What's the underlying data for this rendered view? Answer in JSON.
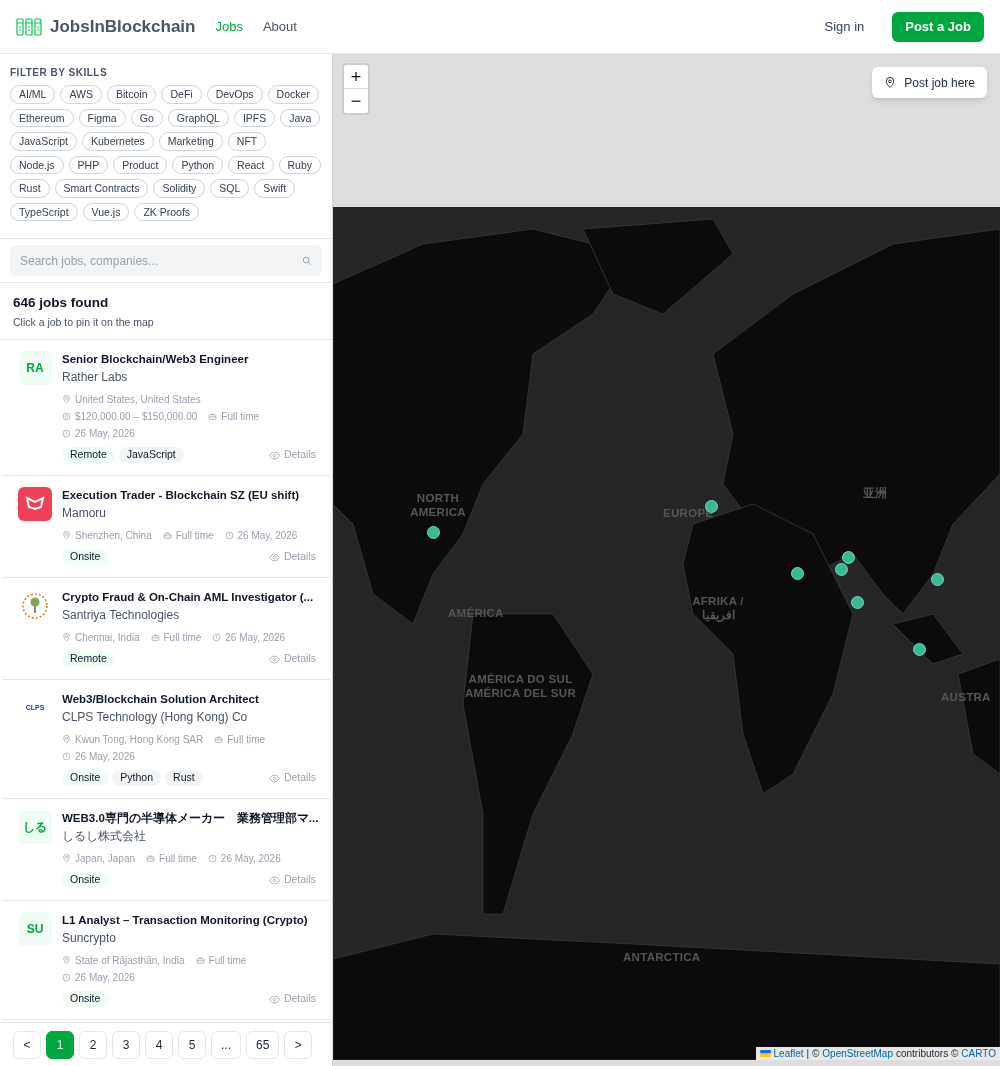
{
  "header": {
    "brand": "JobsInBlockchain",
    "nav": [
      {
        "label": "Jobs",
        "selected": true
      },
      {
        "label": "About",
        "selected": false
      }
    ],
    "sign_in": "Sign in",
    "post_button": "Post a Job"
  },
  "sidebar": {
    "filter_title": "FILTER BY SKILLS",
    "skills": [
      {
        "label": "AI/ML",
        "selected": false
      },
      {
        "label": "AWS",
        "selected": false
      },
      {
        "label": "Bitcoin",
        "selected": false
      },
      {
        "label": "DeFi",
        "selected": false
      },
      {
        "label": "DevOps",
        "selected": false
      },
      {
        "label": "Docker",
        "selected": false
      },
      {
        "label": "Ethereum",
        "selected": false
      },
      {
        "label": "Figma",
        "selected": false
      },
      {
        "label": "Go",
        "selected": false
      },
      {
        "label": "GraphQL",
        "selected": false
      },
      {
        "label": "IPFS",
        "selected": false
      },
      {
        "label": "Java",
        "selected": false
      },
      {
        "label": "JavaScript",
        "selected": false
      },
      {
        "label": "Kubernetes",
        "selected": false
      },
      {
        "label": "Marketing",
        "selected": false
      },
      {
        "label": "NFT",
        "selected": false
      },
      {
        "label": "Node.js",
        "selected": false
      },
      {
        "label": "PHP",
        "selected": false
      },
      {
        "label": "Product",
        "selected": false
      },
      {
        "label": "Python",
        "selected": false
      },
      {
        "label": "React",
        "selected": false
      },
      {
        "label": "Ruby",
        "selected": false
      },
      {
        "label": "Rust",
        "selected": false
      },
      {
        "label": "Smart Contracts",
        "selected": false
      },
      {
        "label": "Solidity",
        "selected": false
      },
      {
        "label": "SQL",
        "selected": false
      },
      {
        "label": "Swift",
        "selected": false
      },
      {
        "label": "TypeScript",
        "selected": false
      },
      {
        "label": "Vue.js",
        "selected": false
      },
      {
        "label": "ZK Proofs",
        "selected": false
      }
    ],
    "search": {
      "placeholder": "Search jobs, companies..."
    },
    "count": "646 jobs found",
    "hint": "Click a job to pin it on the map",
    "jobs": [
      {
        "title": "Senior Blockchain/Web3 Engineer",
        "company": "Rather Labs",
        "logo": {
          "kind": "initials",
          "text": "RA"
        },
        "meta": [
          {
            "kind": "location",
            "text": "United States, United States"
          },
          {
            "kind": "salary",
            "text": "$120,000.00 – $150,000.00"
          },
          {
            "kind": "type",
            "text": "Full time"
          },
          {
            "kind": "date",
            "text": "26 May, 2026"
          }
        ],
        "tags": [
          {
            "kind": "mode",
            "text": "Remote"
          },
          {
            "kind": "skill",
            "text": "JavaScript"
          }
        ],
        "details": "Details"
      },
      {
        "title": "Execution Trader - Blockchain SZ (EU shift)",
        "company": "Mamoru",
        "logo": {
          "kind": "mask"
        },
        "meta": [
          {
            "kind": "location",
            "text": "Shenzhen, China"
          },
          {
            "kind": "type",
            "text": "Full time"
          },
          {
            "kind": "date",
            "text": "26 May, 2026"
          }
        ],
        "tags": [
          {
            "kind": "mode",
            "text": "Onsite"
          }
        ],
        "details": "Details"
      },
      {
        "title": "Crypto Fraud & On-Chain AML Investigator (...",
        "company": "Santriya Technologies",
        "logo": {
          "kind": "tree"
        },
        "meta": [
          {
            "kind": "location",
            "text": "Chennai, India"
          },
          {
            "kind": "type",
            "text": "Full time"
          },
          {
            "kind": "date",
            "text": "26 May, 2026"
          }
        ],
        "tags": [
          {
            "kind": "mode",
            "text": "Remote"
          }
        ],
        "details": "Details"
      },
      {
        "title": "Web3/Blockchain Solution Architect",
        "company": "CLPS Technology (Hong Kong) Co",
        "logo": {
          "kind": "wordmark",
          "text": "CLPS"
        },
        "meta": [
          {
            "kind": "location",
            "text": "Kwun Tong, Hong Kong SAR"
          },
          {
            "kind": "type",
            "text": "Full time"
          },
          {
            "kind": "date",
            "text": "26 May, 2026"
          }
        ],
        "tags": [
          {
            "kind": "mode",
            "text": "Onsite"
          },
          {
            "kind": "skill",
            "text": "Python"
          },
          {
            "kind": "skill",
            "text": "Rust"
          }
        ],
        "details": "Details"
      },
      {
        "title": "WEB3.0専門の半導体メーカー　業務管理部マ...",
        "company": "しるし株式会社",
        "logo": {
          "kind": "initials",
          "text": "しる"
        },
        "meta": [
          {
            "kind": "location",
            "text": "Japan, Japan"
          },
          {
            "kind": "type",
            "text": "Full time"
          },
          {
            "kind": "date",
            "text": "26 May, 2026"
          }
        ],
        "tags": [
          {
            "kind": "mode",
            "text": "Onsite"
          }
        ],
        "details": "Details"
      },
      {
        "title": "L1 Analyst – Transaction Monitoring (Crypto)",
        "company": "Suncrypto",
        "logo": {
          "kind": "initials",
          "text": "SU"
        },
        "meta": [
          {
            "kind": "location",
            "text": "State of Rājasthān, India"
          },
          {
            "kind": "type",
            "text": "Full time"
          },
          {
            "kind": "date",
            "text": "26 May, 2026"
          }
        ],
        "tags": [
          {
            "kind": "mode",
            "text": "Onsite"
          }
        ],
        "details": "Details"
      }
    ],
    "pagination": [
      {
        "label": "<",
        "selected": false
      },
      {
        "label": "1",
        "selected": true
      },
      {
        "label": "2",
        "selected": false
      },
      {
        "label": "3",
        "selected": false
      },
      {
        "label": "4",
        "selected": false
      },
      {
        "label": "5",
        "selected": false
      },
      {
        "label": "...",
        "selected": false
      },
      {
        "label": "65",
        "selected": false
      },
      {
        "label": ">",
        "selected": false
      }
    ]
  },
  "map": {
    "zoom_in": "+",
    "zoom_out": "−",
    "post_here": "Post job here",
    "labels": [
      "NORTH AMERICA",
      "EUROPE",
      "亚洲",
      "AMÉRICA",
      "AFRIKA / افريقيا",
      "AMÉRICA DO SUL AMÉRICA DEL SUR",
      "AUSTRA",
      "ANTARCTICA"
    ],
    "attribution": [
      {
        "text": "Leaflet",
        "link": true
      },
      {
        "text": "| ©",
        "link": false
      },
      {
        "text": "OpenStreetMap",
        "link": true
      },
      {
        "text": "contributors ©",
        "link": false
      },
      {
        "text": "CARTO",
        "link": true
      }
    ]
  }
}
